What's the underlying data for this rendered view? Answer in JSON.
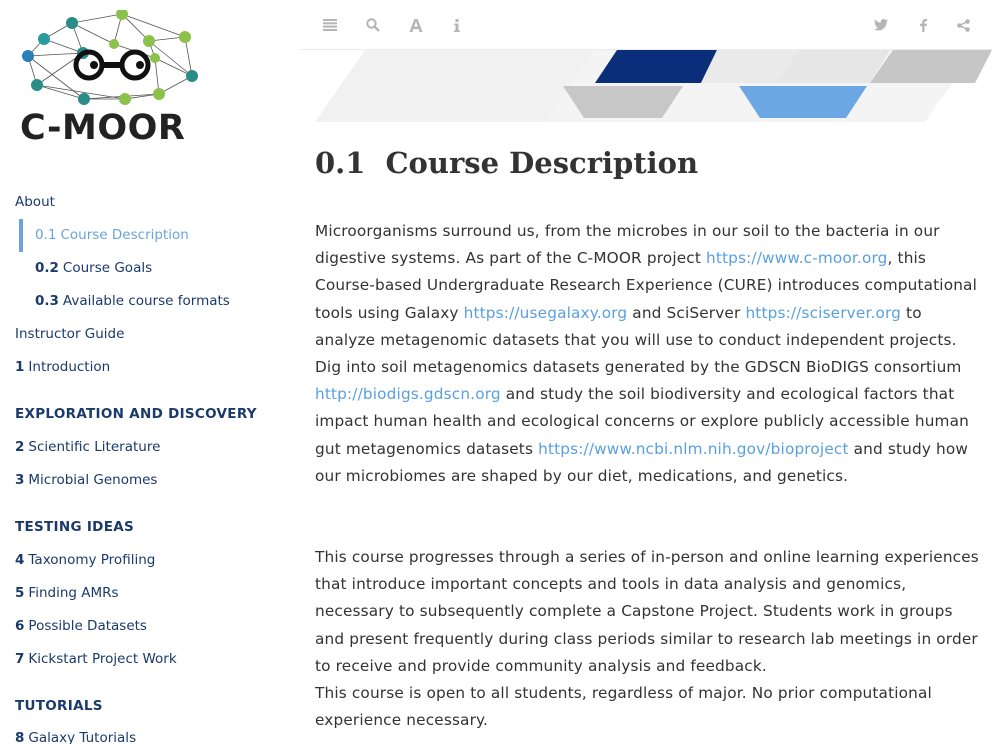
{
  "sidebar": {
    "logo_text": "C-MOOR",
    "items": [
      {
        "num": "",
        "label": "About"
      },
      {
        "num": "0.1",
        "label": "Course Description"
      },
      {
        "num": "0.2",
        "label": "Course Goals"
      },
      {
        "num": "0.3",
        "label": "Available course formats"
      },
      {
        "num": "",
        "label": "Instructor Guide"
      },
      {
        "num": "1",
        "label": "Introduction"
      },
      {
        "num": "2",
        "label": "Scientific Literature"
      },
      {
        "num": "3",
        "label": "Microbial Genomes"
      },
      {
        "num": "4",
        "label": "Taxonomy Profiling"
      },
      {
        "num": "5",
        "label": "Finding AMRs"
      },
      {
        "num": "6",
        "label": "Possible Datasets"
      },
      {
        "num": "7",
        "label": "Kickstart Project Work"
      },
      {
        "num": "8",
        "label": "Galaxy Tutorials"
      }
    ],
    "parts": [
      "EXPLORATION AND DISCOVERY",
      "TESTING IDEAS",
      "TUTORIALS"
    ],
    "active_color": "#6ba3dc",
    "link_color": "#1a3a6b"
  },
  "toolbar": {
    "left_icons": [
      "toc-toggle-icon",
      "search-icon",
      "font-settings-icon",
      "info-icon"
    ],
    "right_icons": [
      "twitter-icon",
      "facebook-icon",
      "share-icon"
    ]
  },
  "section": {
    "number": "0.1",
    "title": "Course Description"
  },
  "para1": {
    "t1": "Microorganisms surround us, from the microbes in our soil to the bacteria in our digestive systems. As part of the C-MOOR project ",
    "l1": "https://www.c-moor.org",
    "t2": ", this Course-based Undergraduate Research Experience (CURE) introduces computational tools using Galaxy ",
    "l2": "https://usegalaxy.org",
    "t3": " and SciServer ",
    "l3": "https://sciserver.org",
    "t4": " to analyze metagenomic datasets that you will use to conduct independent projects. Dig into soil metagenomics datasets generated by the GDSCN BioDIGS consortium ",
    "l4": "http://biodigs.gdscn.org",
    "t5": " and study the soil biodiversity and ecological factors that impact human health and ecological concerns or explore publicly accessible human gut metagenomics datasets ",
    "l5": "https://www.ncbi.nlm.nih.gov/bioproject",
    "t6": " and study how our microbiomes are shaped by our diet, medications, and genetics."
  },
  "para2": "This course progresses through a series of in-person and online learning experiences that introduce important concepts and tools in data analysis and genomics, necessary to subsequently complete a Capstone Project. Students work in groups and present frequently during class periods similar to research lab meetings in order to receive and provide community analysis and feedback.",
  "para3": "This course is open to all students, regardless of major. No prior computational experience necessary.",
  "colors": {
    "text": "#333333",
    "link": "#5aa0e0",
    "banner_dark": "#0b2e7a",
    "banner_light": "#6ba7e3",
    "banner_grey": "#c4c4c4",
    "logo_green": "#8bc34a",
    "logo_teal": "#2a8c86"
  }
}
